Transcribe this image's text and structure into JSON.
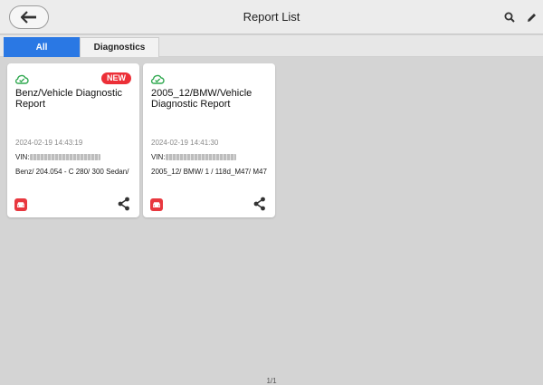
{
  "header": {
    "title": "Report List",
    "back_icon": "arrow-left-icon",
    "search_icon": "search-icon",
    "edit_icon": "pencil-icon"
  },
  "tabs": [
    {
      "label": "All",
      "selected": true
    },
    {
      "label": "Diagnostics",
      "selected": false
    }
  ],
  "reports": [
    {
      "title": "Benz/Vehicle Diagnostic Report",
      "badge": "NEW",
      "time": "2024-02-19 14:43:19",
      "vin_label": "VIN:",
      "model": "Benz/ 204.054 - C 280/ 300 Sedan/",
      "status_icon": "cloud-check-icon",
      "type_icon": "car-icon",
      "action_icon": "share-icon"
    },
    {
      "title": "2005_12/BMW/Vehicle Diagnostic Report",
      "badge": "",
      "time": "2024-02-19 14:41:30",
      "vin_label": "VIN:",
      "model": "2005_12/ BMW/ 1 / 118d_M47/ M47",
      "status_icon": "cloud-check-icon",
      "type_icon": "car-icon",
      "action_icon": "share-icon"
    }
  ],
  "pagination": {
    "label": "1/1"
  },
  "colors": {
    "accent": "#2a78e4",
    "badge": "#ec2f37",
    "cloud": "#2fa84f",
    "car": "#e8383f",
    "background": "#d4d4d4"
  }
}
